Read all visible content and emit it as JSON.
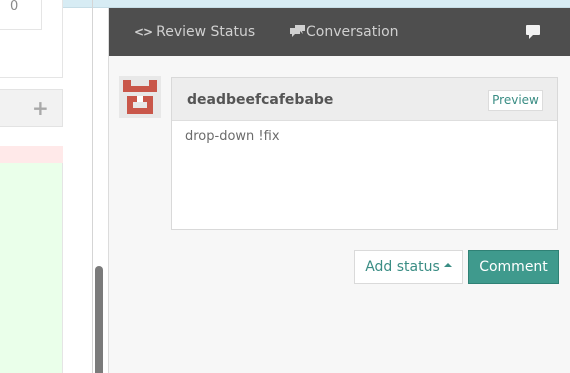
{
  "left_panel": {
    "card_digit": "0",
    "add_label": "+"
  },
  "review": {
    "tabs": [
      {
        "label": "Review Status",
        "icon": "code-icon"
      },
      {
        "label": "Conversation",
        "icon": "chat-bubbles-icon"
      }
    ],
    "speech_icon": "speech-bubble-icon"
  },
  "comment": {
    "author": "deadbeefcafebabe",
    "preview_label": "Preview",
    "text": "drop-down !fix"
  },
  "actions": {
    "add_status_label": "Add status",
    "comment_label": "Comment"
  },
  "colors": {
    "accent": "#3f9a8d",
    "tabs_bg": "#4e4e4e",
    "avatar": "#c9574a"
  }
}
